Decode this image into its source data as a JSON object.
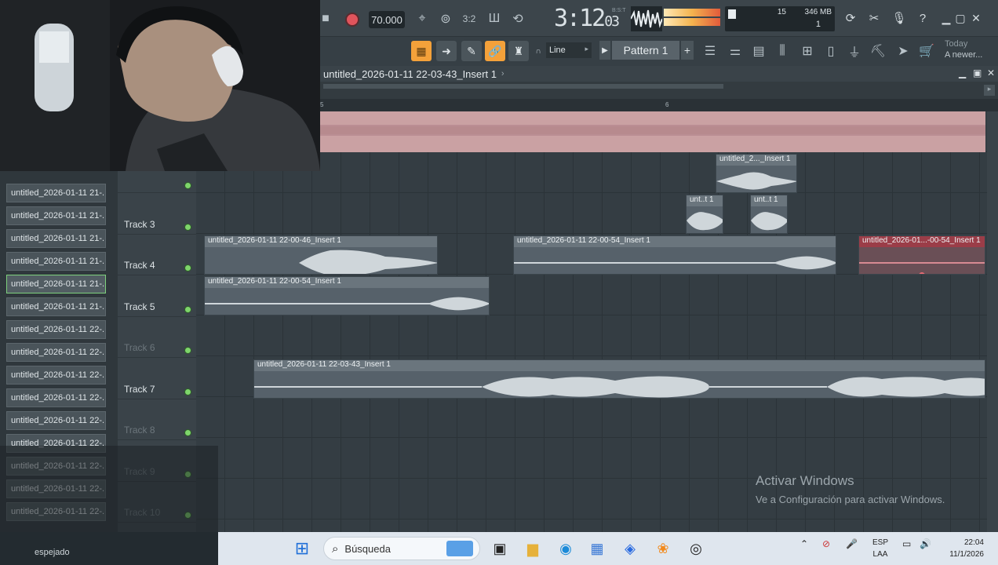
{
  "toolbar": {
    "tempo": "70.000",
    "time_main": "3:12",
    "time_frac": "03",
    "time_label": "B:S:T",
    "cpu_poly": "15",
    "cpu_mem": "346 MB",
    "cpu_num": "1",
    "snap": "Line",
    "pattern": "Pattern 1",
    "news_title": "Today",
    "news_text": "A newer..."
  },
  "playlist": {
    "title": "untitled_2026-01-11 22-03-43_Insert 1",
    "ruler_marks": [
      "5",
      "6"
    ]
  },
  "browser": {
    "items": [
      "untitled_2026-01-11 21-...",
      "untitled_2026-01-11 21-...",
      "untitled_2026-01-11 21-...",
      "untitled_2026-01-11 21-...",
      "untitled_2026-01-11 21-...",
      "untitled_2026-01-11 21-...",
      "untitled_2026-01-11 22-...",
      "untitled_2026-01-11 22-...",
      "untitled_2026-01-11 22-...",
      "untitled_2026-01-11 22-...",
      "untitled_2026-01-11 22-...",
      "untitled_2026-01-11 22-...",
      "untitled_2026-01-11 22-...",
      "untitled_2026-01-11 22-...",
      "untitled_2026-01-11 22-..."
    ],
    "selected_index": 4
  },
  "tracks": [
    {
      "name": "",
      "dim": false
    },
    {
      "name": "Track 3",
      "dim": false
    },
    {
      "name": "Track 4",
      "dim": false
    },
    {
      "name": "Track 5",
      "dim": false
    },
    {
      "name": "Track 6",
      "dim": true
    },
    {
      "name": "Track 7",
      "dim": false
    },
    {
      "name": "Track 8",
      "dim": true
    },
    {
      "name": "Track 9",
      "dim": true
    },
    {
      "name": "Track 10",
      "dim": true
    }
  ],
  "clips": {
    "c1": "untitled_2..._Insert 1",
    "c2": "unt..t 1",
    "c3": "unt..t 1",
    "c4": "untitled_2026-01-11 22-00-46_Insert 1",
    "c5": "untitled_2026-01-11 22-00-54_Insert 1",
    "c6": "untitled_2026-01...-00-54_Insert 1",
    "c7": "untitled_2026-01-11 22-00-54_Insert 1",
    "c8": "untitled_2026-01-11 22-03-43_Insert 1"
  },
  "watermark": {
    "line1": "Activar Windows",
    "line2": "Ve a Configuración para activar Windows."
  },
  "chat": {
    "bottom": "espejado"
  },
  "taskbar": {
    "search_placeholder": "Búsqueda",
    "lang_top": "ESP",
    "lang_bottom": "LAA",
    "time": "22:04",
    "date": "11/1/2026"
  },
  "colors": {
    "accent": "#f4a13a",
    "record": "#e0545c",
    "led": "#7ed56b",
    "master_clip": "#caa1a3",
    "red_clip": "#9b3d48"
  }
}
